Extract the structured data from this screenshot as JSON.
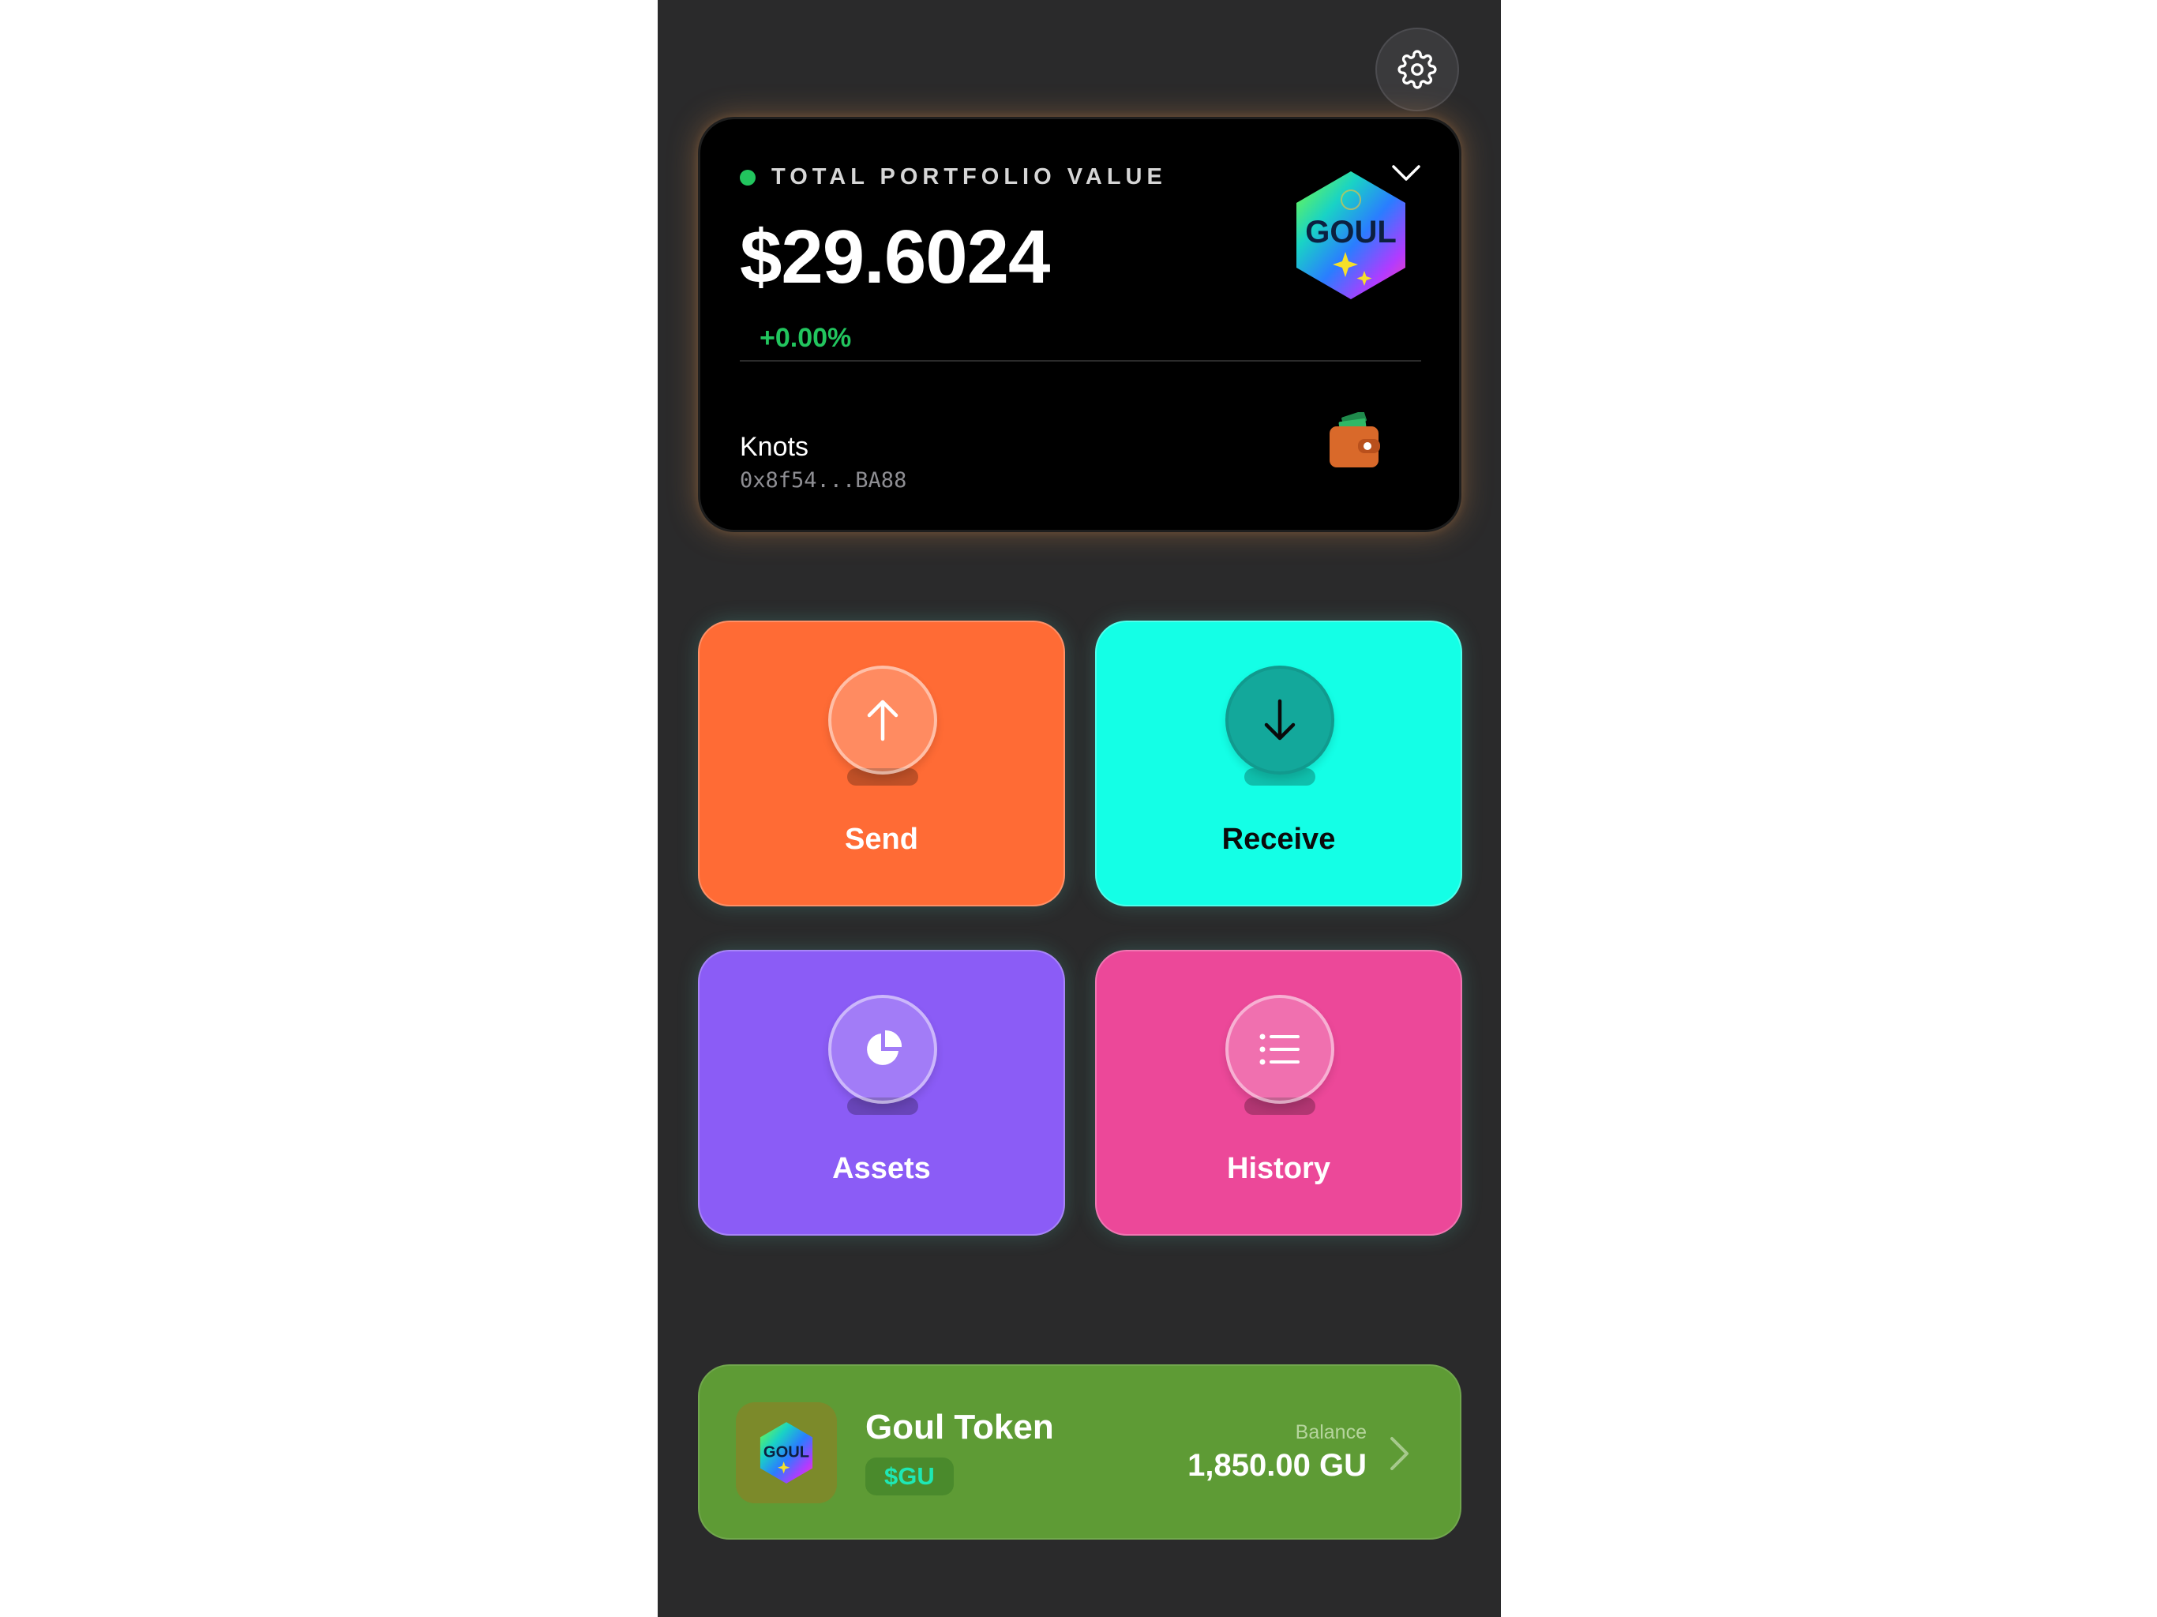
{
  "header": {
    "settings_icon": "gear-icon"
  },
  "portfolio": {
    "label": "TOTAL PORTFOLIO VALUE",
    "value": "$29.6024",
    "change": "+0.00%",
    "status_color": "#22c55e",
    "logo_text": "GOUL",
    "expand_icon": "chevron-down-icon",
    "account_name": "Knots",
    "account_address": "0x8f54...BA88",
    "wallet_icon": "wallet-icon"
  },
  "actions": [
    {
      "label": "Send",
      "icon": "arrow-up-icon",
      "color": "#ff6b35"
    },
    {
      "label": "Receive",
      "icon": "arrow-down-icon",
      "color": "#14ffe6"
    },
    {
      "label": "Assets",
      "icon": "pie-chart-icon",
      "color": "#8b5cf6"
    },
    {
      "label": "History",
      "icon": "list-icon",
      "color": "#ec4899"
    }
  ],
  "token": {
    "name": "Goul Token",
    "symbol": "$GU",
    "balance_label": "Balance",
    "balance": "1,850.00 GU",
    "logo_text": "GOUL",
    "chevron_icon": "chevron-right-icon",
    "card_color": "#5e9b35"
  }
}
